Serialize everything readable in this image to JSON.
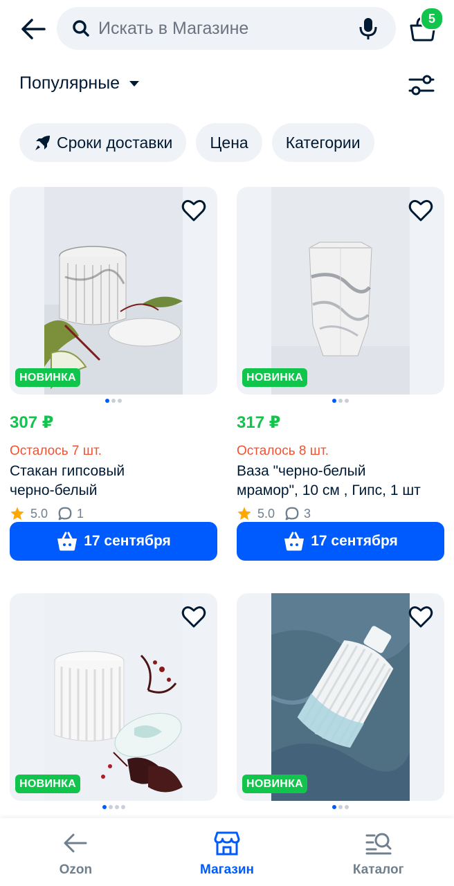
{
  "header": {
    "search_placeholder": "Искать в Магазине",
    "cart_count": "5"
  },
  "sort": {
    "label": "Популярные"
  },
  "chips": [
    {
      "label": "Сроки доставки",
      "icon": "rocket-icon"
    },
    {
      "label": "Цена"
    },
    {
      "label": "Категории"
    }
  ],
  "products": [
    {
      "badge": "НОВИНКА",
      "price": "307 ₽",
      "stock": "Осталось 7 шт.",
      "title_line1": "Стакан гипсовый",
      "title_line2": "черно-белый",
      "rating": "5.0",
      "reviews": "1",
      "delivery": "17 сентября",
      "image_count": 3
    },
    {
      "badge": "НОВИНКА",
      "price": "317 ₽",
      "stock": "Осталось 8 шт.",
      "title_line1": "Ваза \"черно-белый",
      "title_line2": "мрамор\", 10 см , Гипс, 1 шт",
      "rating": "5.0",
      "reviews": "3",
      "delivery": "17 сентября",
      "image_count": 3
    },
    {
      "badge": "НОВИНКА",
      "image_count": 4
    },
    {
      "badge": "НОВИНКА",
      "image_count": 3
    }
  ],
  "bottom_nav": [
    {
      "label": "Ozon",
      "icon": "arrow-left-icon"
    },
    {
      "label": "Магазин",
      "icon": "store-icon",
      "active": true
    },
    {
      "label": "Каталог",
      "icon": "catalog-search-icon"
    }
  ],
  "colors": {
    "accent": "#005bff",
    "green": "#10c44c",
    "stock_red": "#f1522f",
    "chip_bg": "#eff2f6",
    "text": "#001a34",
    "muted": "#707f8d"
  }
}
